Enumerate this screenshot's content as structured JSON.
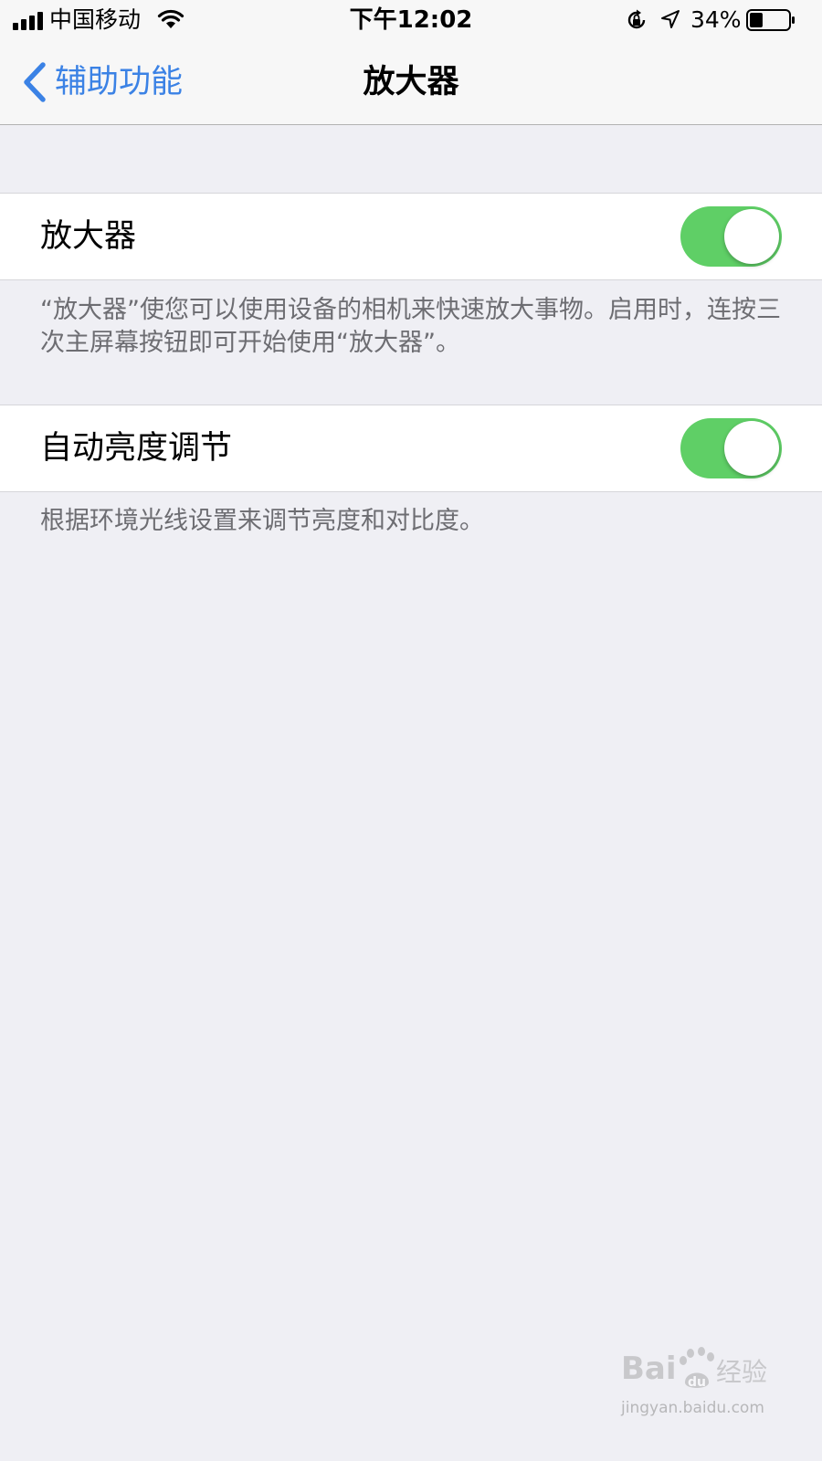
{
  "status_bar": {
    "carrier": "中国移动",
    "time": "下午12:02",
    "battery_percent": "34%",
    "battery_level": 0.34
  },
  "nav": {
    "back_label": "辅助功能",
    "title": "放大器",
    "accent_color": "#3B82E5"
  },
  "settings": [
    {
      "label": "放大器",
      "enabled": true,
      "footer": "“放大器”使您可以使用设备的相机来快速放大事物。启用时，连按三次主屏幕按钮即可开始使用“放大器”。"
    },
    {
      "label": "自动亮度调节",
      "enabled": true,
      "footer": "根据环境光线设置来调节亮度和对比度。"
    }
  ],
  "toggle_on_color": "#5FCF66",
  "watermark": {
    "logo_text": "Baidu经验",
    "url": "jingyan.baidu.com"
  }
}
